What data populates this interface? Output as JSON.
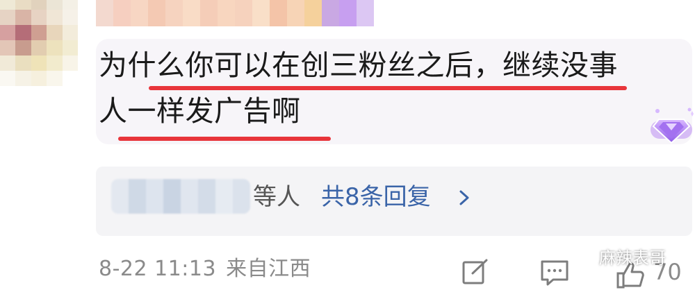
{
  "comment": {
    "line1": "为什么你可以在创三粉丝之后，继续没事",
    "line2": "人一样发广告啊"
  },
  "replies": {
    "suffix": "等人",
    "link": "共8条回复",
    "chevron_icon": "chevron-right-icon"
  },
  "meta": {
    "date": "8-22 11:13",
    "location": "来自江西"
  },
  "actions": {
    "share_icon": "share-icon",
    "reply_icon": "comment-icon",
    "like_icon": "thumbs-up-icon",
    "like_count": "70"
  },
  "watermark": {
    "text": "麻辣表哥"
  },
  "colors": {
    "underline": "#e8353b",
    "link": "#3a64a8",
    "bubble": "#f7f5f9",
    "meta": "#8a8a8a"
  }
}
